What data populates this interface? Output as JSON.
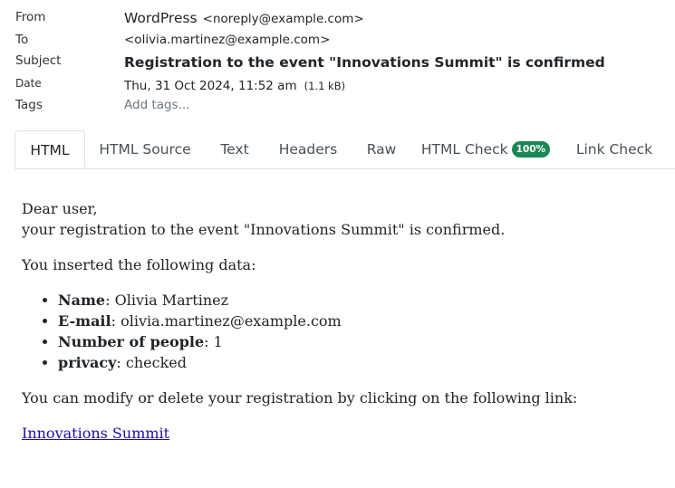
{
  "header": {
    "from_label": "From",
    "from_name": "WordPress",
    "from_email": "<noreply@example.com>",
    "to_label": "To",
    "to_email": "<olivia.martinez@example.com>",
    "subject_label": "Subject",
    "subject": "Registration to the event \"Innovations Summit\" is confirmed",
    "date_label": "Date",
    "date": "Thu, 31 Oct 2024, 11:52 am",
    "size": "(1.1 kB)",
    "tags_label": "Tags",
    "tags_placeholder": "Add tags..."
  },
  "tabs": [
    {
      "label": "HTML",
      "active": true
    },
    {
      "label": "HTML Source"
    },
    {
      "label": "Text"
    },
    {
      "label": "Headers"
    },
    {
      "label": "Raw"
    },
    {
      "label": "HTML Check",
      "badge": "100%"
    },
    {
      "label": "Link Check"
    }
  ],
  "colors": {
    "badge": "#198754",
    "link": "#1a0dab"
  },
  "message": {
    "greeting": "Dear user,",
    "line1": "your registration to the event \"Innovations Summit\" is confirmed.",
    "intro": "You inserted the following data:",
    "fields": [
      {
        "key": "Name",
        "value": ": Olivia Martinez"
      },
      {
        "key": "E-mail",
        "value": ": olivia.martinez@example.com"
      },
      {
        "key": "Number of people",
        "value": ": 1"
      },
      {
        "key": "privacy",
        "value": ": checked"
      }
    ],
    "modify_text": "You can modify or delete your registration by clicking on the following link:",
    "link_text": "Innovations Summit"
  }
}
